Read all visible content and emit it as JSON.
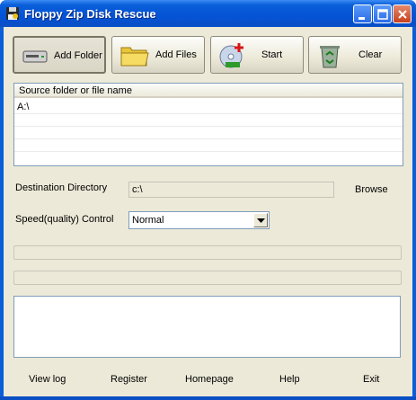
{
  "window": {
    "title": "Floppy Zip Disk Rescue"
  },
  "toolbar": {
    "add_folder": "Add Folder",
    "add_files": "Add Files",
    "start": "Start",
    "clear": "Clear"
  },
  "source_list": {
    "column_header": "Source folder or file name",
    "items": [
      "A:\\"
    ]
  },
  "destination": {
    "label": "Destination Directory",
    "value": "c:\\",
    "browse": "Browse"
  },
  "speed": {
    "label": "Speed(quality) Control",
    "selected": "Normal"
  },
  "progress": {
    "bar1_fraction": 0.0,
    "bar2_fraction": 0.0
  },
  "log": {
    "text": ""
  },
  "footer": {
    "view_log": "View log",
    "register": "Register",
    "homepage": "Homepage",
    "help": "Help",
    "exit": "Exit"
  },
  "icons": {
    "app": "floppy-disk-icon",
    "add_folder": "drive-icon",
    "add_files": "folder-icon",
    "start": "cd-start-icon",
    "clear": "recycle-bin-icon"
  },
  "colors": {
    "titlebar": "#0a5fd8",
    "dialog_bg": "#ece9d8",
    "close_button": "#c8401c"
  }
}
